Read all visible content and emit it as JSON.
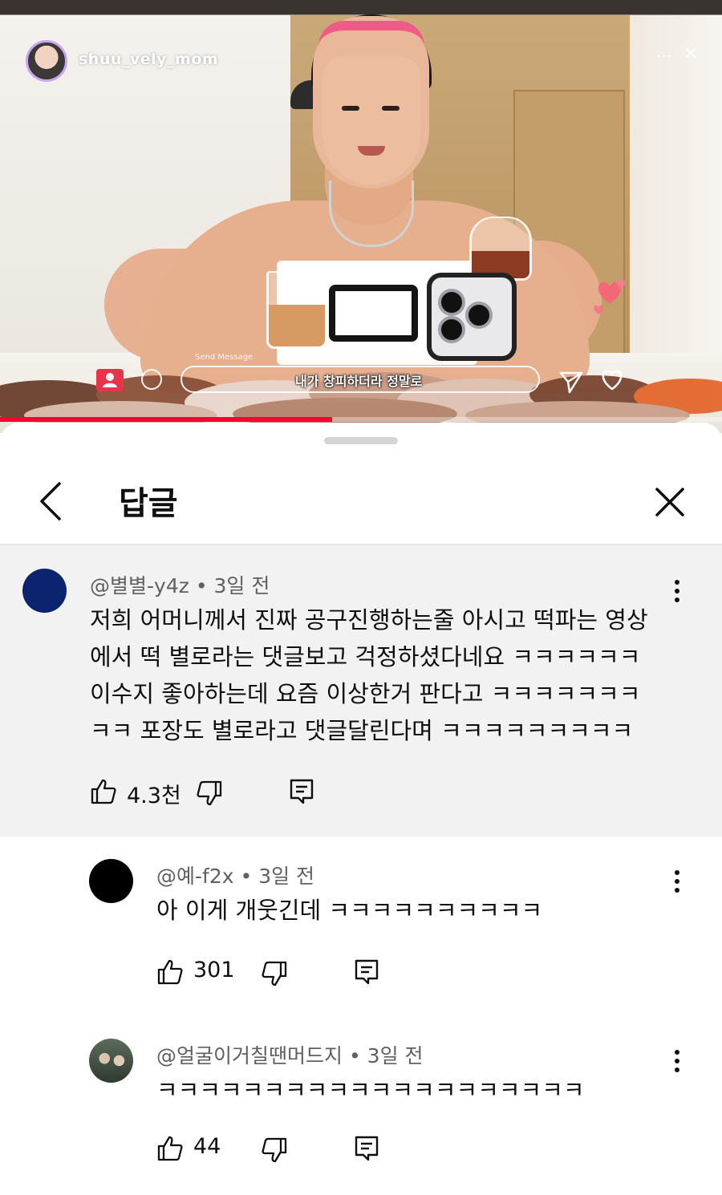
{
  "video": {
    "account_name": "shuu_vely_mom",
    "more_label": "···",
    "close_label": "✕",
    "message_label": "Send Message",
    "caption": "내가 창피하더라 정말로",
    "progress": 0.46
  },
  "sheet": {
    "title": "답글"
  },
  "comments": [
    {
      "author": "@별별-y4z",
      "time": "3일 전",
      "lines": [
        "저희 어머니께서 진짜 공구진행하는줄 아시고 떡파는 영상",
        "에서 떡 별로라는 댓글보고 걱정하셨다네요 ㅋㅋㅋㅋㅋㅋ",
        "이수지 좋아하는데 요즘 이상한거 판다고 ㅋㅋㅋㅋㅋㅋㅋ",
        "ㅋㅋ 포장도 별로라고 댓글달린다며 ㅋㅋㅋㅋㅋㅋㅋㅋㅋ"
      ],
      "likes": "4.3천",
      "avatar_color": "#0c2470"
    },
    {
      "author": "@예-f2x",
      "time": "3일 전",
      "lines": [
        "아 이게 개웃긴데 ㅋㅋㅋㅋㅋㅋㅋㅋㅋㅋ"
      ],
      "likes": "301",
      "avatar_color": "#000000"
    },
    {
      "author": "@얼굴이거칠땐머드지",
      "time": "3일 전",
      "lines": [
        "ㅋㅋㅋㅋㅋㅋㅋㅋㅋㅋㅋㅋㅋㅋㅋㅋㅋㅋㅋㅋ"
      ],
      "likes": "44",
      "avatar_color": "#4b5a4c"
    }
  ],
  "colors": {
    "accent_red": "#ff0033",
    "parent_bg": "#f2f2f2",
    "meta_gray": "#606060"
  }
}
